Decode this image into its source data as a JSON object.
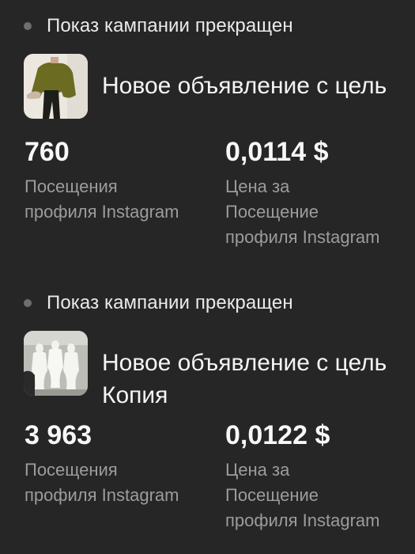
{
  "campaigns": [
    {
      "status": "Показ кампании прекращен",
      "title_lines": [
        "Новое объявление с цель"
      ],
      "thumbnail_icon": "ad-photo-person-olive-jacket",
      "metrics": {
        "visits_value": "760",
        "visits_label_lines": [
          "Посещения",
          "профиля Instagram"
        ],
        "cost_value": "0,0114 $",
        "cost_label_lines": [
          "Цена за",
          "Посещение",
          "профиля Instagram"
        ]
      }
    },
    {
      "status": "Показ кампании прекращен",
      "title_lines": [
        "Новое объявление с цель",
        "Копия"
      ],
      "thumbnail_icon": "ad-photo-white-mannequins",
      "metrics": {
        "visits_value": "3 963",
        "visits_label_lines": [
          "Посещения",
          "профиля Instagram"
        ],
        "cost_value": "0,0122 $",
        "cost_label_lines": [
          "Цена за",
          "Посещение",
          "профиля Instagram"
        ]
      }
    }
  ],
  "colors": {
    "background": "#262626",
    "status_dot": "#6f6f6f",
    "primary_text": "#f5f5f5",
    "secondary_text": "#9c9c9c"
  }
}
